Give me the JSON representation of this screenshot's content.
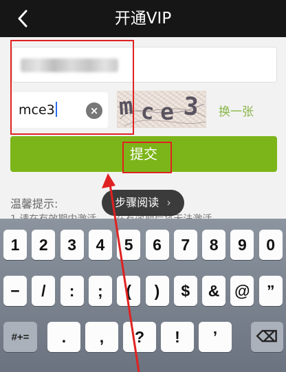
{
  "navbar": {
    "title": "开通VIP",
    "back_glyph": "‹"
  },
  "form": {
    "captcha_value": "mce3",
    "captcha_image_text": "mce3",
    "refresh_label": "换一张",
    "clear_glyph": "×",
    "submit_label": "提交"
  },
  "tips": {
    "title": "温馨提示:",
    "line1": "1.请在有效期内激活……在有效期后将无法激活"
  },
  "toast": {
    "label": "步骤阅读",
    "chevron": "›"
  },
  "keyboard": {
    "row1": [
      "1",
      "2",
      "3",
      "4",
      "5",
      "6",
      "7",
      "8",
      "9",
      "0"
    ],
    "row2": [
      "−",
      "/",
      ":",
      ";",
      "(",
      ")",
      "$",
      "&",
      "@",
      "”"
    ],
    "row3": [
      "#+=",
      ".",
      ",",
      "?",
      "!",
      "’",
      "⌫"
    ]
  },
  "colors": {
    "accent": "#7cb519",
    "annotation": "#e02121",
    "navbar": "#161616"
  }
}
